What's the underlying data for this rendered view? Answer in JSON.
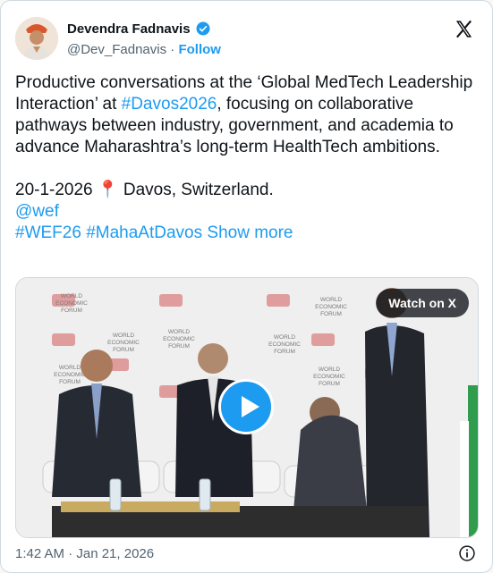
{
  "author": {
    "name": "Devendra Fadnavis",
    "handle": "@Dev_Fadnavis",
    "separator": "·",
    "follow_label": "Follow"
  },
  "tweet": {
    "p1_part1": "Productive conversations at the ‘Global MedTech Leadership Interaction’ at ",
    "p1_hashtag": "#Davos2026",
    "p1_part2": ", focusing on collaborative pathways between industry, government, and academia to advance Maharashtra’s long-term HealthTech ambitions.",
    "date": "20-1-2026",
    "pin": "📍",
    "location": " Davos, Switzerland.",
    "mention": "@wef",
    "hashtag1": "#WEF26",
    "hashtag2": "#MahaAtDavos",
    "show_more": "Show more"
  },
  "media": {
    "watch_label": "Watch on X",
    "backdrop_text": [
      "WORLD",
      "ECONOMIC",
      "FORUM"
    ]
  },
  "footer": {
    "timestamp": "1:42 AM · Jan 21, 2026"
  },
  "icons": {
    "verified": "verified-badge-icon",
    "x_logo": "x-logo-icon",
    "play": "play-icon",
    "info": "info-icon"
  },
  "colors": {
    "accent": "#1d9bf0",
    "text": "#0f1419",
    "muted": "#536471"
  }
}
